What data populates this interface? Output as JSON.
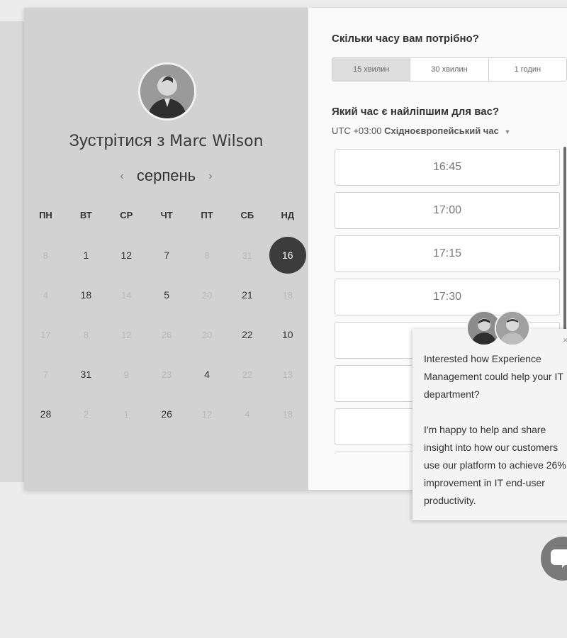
{
  "host": {
    "title_prefix": "Зустрітися з",
    "name": "Marc Wilson"
  },
  "calendar": {
    "month": "серпень",
    "weekdays": [
      "ПН",
      "ВТ",
      "СР",
      "ЧТ",
      "ПТ",
      "СБ",
      "НД"
    ],
    "days": [
      {
        "label": "8",
        "state": "muted"
      },
      {
        "label": "1",
        "state": "active"
      },
      {
        "label": "12",
        "state": "active"
      },
      {
        "label": "7",
        "state": "active"
      },
      {
        "label": "8",
        "state": "muted"
      },
      {
        "label": "31",
        "state": "muted"
      },
      {
        "label": "16",
        "state": "selected"
      },
      {
        "label": "4",
        "state": "muted"
      },
      {
        "label": "18",
        "state": "active"
      },
      {
        "label": "14",
        "state": "muted"
      },
      {
        "label": "5",
        "state": "active"
      },
      {
        "label": "20",
        "state": "muted"
      },
      {
        "label": "21",
        "state": "active"
      },
      {
        "label": "18",
        "state": "muted"
      },
      {
        "label": "17",
        "state": "muted"
      },
      {
        "label": "8",
        "state": "muted"
      },
      {
        "label": "12",
        "state": "muted"
      },
      {
        "label": "26",
        "state": "muted"
      },
      {
        "label": "20",
        "state": "muted"
      },
      {
        "label": "22",
        "state": "active"
      },
      {
        "label": "10",
        "state": "active"
      },
      {
        "label": "7",
        "state": "muted"
      },
      {
        "label": "31",
        "state": "active"
      },
      {
        "label": "9",
        "state": "muted"
      },
      {
        "label": "23",
        "state": "muted"
      },
      {
        "label": "4",
        "state": "active"
      },
      {
        "label": "22",
        "state": "muted"
      },
      {
        "label": "13",
        "state": "muted"
      },
      {
        "label": "28",
        "state": "active"
      },
      {
        "label": "2",
        "state": "muted"
      },
      {
        "label": "1",
        "state": "muted"
      },
      {
        "label": "26",
        "state": "active"
      },
      {
        "label": "12",
        "state": "muted"
      },
      {
        "label": "4",
        "state": "muted"
      },
      {
        "label": "18",
        "state": "muted"
      }
    ]
  },
  "duration": {
    "title": "Скільки часу вам потрібно?",
    "options": [
      "15 хвилин",
      "30 хвилин",
      "1 годин"
    ],
    "selected_index": 0
  },
  "time": {
    "title": "Який час є найліпшим для вас?",
    "tz_offset": "UTC +03:00",
    "tz_name": "Східноєвропейський час",
    "slots": [
      "16:45",
      "17:00",
      "17:15",
      "17:30",
      "",
      "",
      "",
      ""
    ]
  },
  "chat": {
    "message": "Interested how Experience Management could help your IT department?\n\nI'm happy to help and share insight into how our customers use our platform to achieve 26% improvement in IT end-user productivity."
  }
}
